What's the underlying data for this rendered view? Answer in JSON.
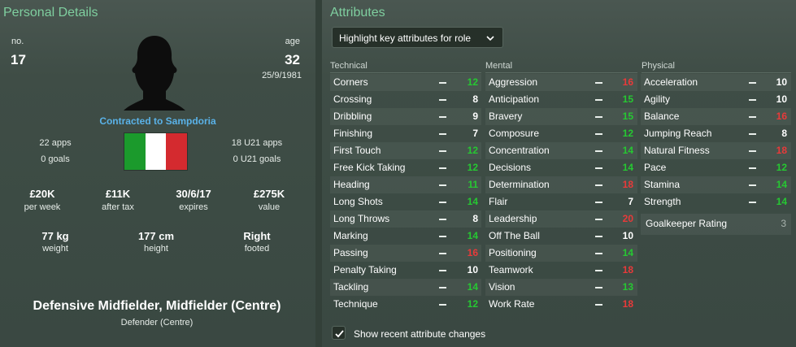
{
  "personal": {
    "title": "Personal Details",
    "no_label": "no.",
    "no_value": "17",
    "age_label": "age",
    "age_value": "32",
    "dob": "25/9/1981",
    "contracted": "Contracted to Sampdoria",
    "apps": "22 apps",
    "goals": "0 goals",
    "u21_apps": "18 U21 apps",
    "u21_goals": "0 U21 goals",
    "flag_colors": [
      "#1b9a2c",
      "#ffffff",
      "#d42a2f"
    ],
    "flag_icon": "italy-flag-icon",
    "stats": [
      {
        "value": "£20K",
        "label": "per week"
      },
      {
        "value": "£11K",
        "label": "after tax"
      },
      {
        "value": "30/6/17",
        "label": "expires"
      },
      {
        "value": "£275K",
        "label": "value"
      }
    ],
    "physical": [
      {
        "value": "77 kg",
        "label": "weight"
      },
      {
        "value": "177 cm",
        "label": "height"
      },
      {
        "value": "Right",
        "label": "footed"
      }
    ],
    "position": "Defensive Midfielder, Midfielder (Centre)",
    "secondary_position": "Defender (Centre)"
  },
  "attributes": {
    "title": "Attributes",
    "dropdown_label": "Highlight key attributes for role",
    "columns": [
      {
        "name": "Technical",
        "items": [
          {
            "name": "Corners",
            "value": "12",
            "color": "green"
          },
          {
            "name": "Crossing",
            "value": "8",
            "color": "white"
          },
          {
            "name": "Dribbling",
            "value": "9",
            "color": "white"
          },
          {
            "name": "Finishing",
            "value": "7",
            "color": "white"
          },
          {
            "name": "First Touch",
            "value": "12",
            "color": "green"
          },
          {
            "name": "Free Kick Taking",
            "value": "12",
            "color": "green"
          },
          {
            "name": "Heading",
            "value": "11",
            "color": "green"
          },
          {
            "name": "Long Shots",
            "value": "14",
            "color": "green"
          },
          {
            "name": "Long Throws",
            "value": "8",
            "color": "white"
          },
          {
            "name": "Marking",
            "value": "14",
            "color": "green"
          },
          {
            "name": "Passing",
            "value": "16",
            "color": "red"
          },
          {
            "name": "Penalty Taking",
            "value": "10",
            "color": "white"
          },
          {
            "name": "Tackling",
            "value": "14",
            "color": "green"
          },
          {
            "name": "Technique",
            "value": "12",
            "color": "green"
          }
        ]
      },
      {
        "name": "Mental",
        "items": [
          {
            "name": "Aggression",
            "value": "16",
            "color": "red"
          },
          {
            "name": "Anticipation",
            "value": "15",
            "color": "green"
          },
          {
            "name": "Bravery",
            "value": "15",
            "color": "green"
          },
          {
            "name": "Composure",
            "value": "12",
            "color": "green"
          },
          {
            "name": "Concentration",
            "value": "14",
            "color": "green"
          },
          {
            "name": "Decisions",
            "value": "14",
            "color": "green"
          },
          {
            "name": "Determination",
            "value": "18",
            "color": "red"
          },
          {
            "name": "Flair",
            "value": "7",
            "color": "white"
          },
          {
            "name": "Leadership",
            "value": "20",
            "color": "red"
          },
          {
            "name": "Off The Ball",
            "value": "10",
            "color": "white"
          },
          {
            "name": "Positioning",
            "value": "14",
            "color": "green"
          },
          {
            "name": "Teamwork",
            "value": "18",
            "color": "red"
          },
          {
            "name": "Vision",
            "value": "13",
            "color": "green"
          },
          {
            "name": "Work Rate",
            "value": "18",
            "color": "red"
          }
        ]
      },
      {
        "name": "Physical",
        "items": [
          {
            "name": "Acceleration",
            "value": "10",
            "color": "white"
          },
          {
            "name": "Agility",
            "value": "10",
            "color": "white"
          },
          {
            "name": "Balance",
            "value": "16",
            "color": "red"
          },
          {
            "name": "Jumping Reach",
            "value": "8",
            "color": "white"
          },
          {
            "name": "Natural Fitness",
            "value": "18",
            "color": "red"
          },
          {
            "name": "Pace",
            "value": "12",
            "color": "green"
          },
          {
            "name": "Stamina",
            "value": "14",
            "color": "green"
          },
          {
            "name": "Strength",
            "value": "14",
            "color": "green"
          }
        ]
      }
    ],
    "goalkeeper_label": "Goalkeeper Rating",
    "goalkeeper_value": "3",
    "show_changes_label": "Show recent attribute changes",
    "show_changes_checked": true
  }
}
